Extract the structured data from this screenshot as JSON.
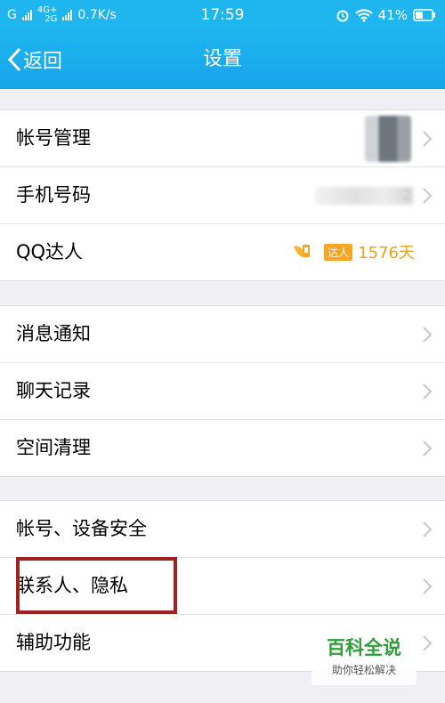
{
  "status_bar": {
    "carrier": "G",
    "network_top": "4G+",
    "network_bottom": "2G",
    "speed": "0.7K/s",
    "time": "17:59",
    "battery": "41%"
  },
  "navbar": {
    "back_label": "返回",
    "title": "设置"
  },
  "group1": [
    {
      "label": "帐号管理"
    },
    {
      "label": "手机号码",
      "value_suffix": "2"
    },
    {
      "label": "QQ达人",
      "badge": "达人",
      "days": "1576天"
    }
  ],
  "group2": [
    {
      "label": "消息通知"
    },
    {
      "label": "聊天记录"
    },
    {
      "label": "空间清理"
    }
  ],
  "group3": [
    {
      "label": "帐号、设备安全"
    },
    {
      "label": "联系人、隐私"
    },
    {
      "label": "辅助功能"
    }
  ],
  "watermark": {
    "title": "百科全说",
    "subtitle": "助你轻松解决"
  },
  "colors": {
    "accent": "#1fb5ef",
    "highlight": "#a3201f",
    "qq_gold": "#e8a31c"
  }
}
